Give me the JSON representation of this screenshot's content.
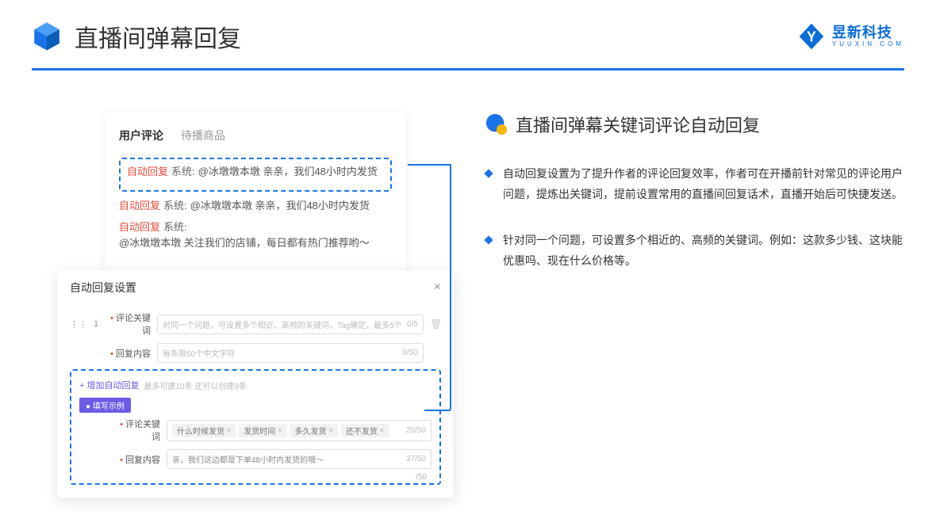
{
  "header": {
    "title": "直播间弹幕回复",
    "logo_cn": "昱新科技",
    "logo_en": "YUUXIN.COM"
  },
  "card1": {
    "tabs": {
      "user_comment": "用户评论",
      "goods": "待播商品"
    },
    "auto_tag": "自动回复",
    "sys_tag": "系统:",
    "c1": "@冰墩墩本墩 亲亲，我们48小时内发货",
    "c2": "@冰墩墩本墩 亲亲，我们48小时内发货",
    "c3": "@冰墩墩本墩 关注我们的店铺，每日都有热门推荐哟～"
  },
  "card2": {
    "title": "自动回复设置",
    "idx": "1",
    "lbl_keyword": "评论关键词",
    "ph_keyword": "对同一个问题，可设置多个相近、高频的关键词，Tag确定，最多5个",
    "count_keyword": "0/5",
    "lbl_content": "回复内容",
    "ph_content": "每条限50个中文字符",
    "count_content": "0/50",
    "add_link": "+ 增加自动回复",
    "add_hint": "最多可建10条 还可以创建9条",
    "badge": "● 填写示例",
    "ex_lbl_keyword": "评论关键词",
    "ex_tags": [
      "什么时候发货",
      "发货时间",
      "多久发货",
      "还不发货"
    ],
    "ex_kw_count": "20/50",
    "ex_lbl_content": "回复内容",
    "ex_content_text": "亲，我们这边都是下单48小时内发货的哦～",
    "ex_content_count": "37/50",
    "ext_count": "/50"
  },
  "right": {
    "title": "直播间弹幕关键词评论自动回复",
    "p1": "自动回复设置为了提升作者的评论回复效率，作者可在开播前针对常见的评论用户问题，提炼出关键词，提前设置常用的直播间回复话术，直播开始后可快捷发送。",
    "p2": "针对同一个问题，可设置多个相近的、高频的关键词。例如：这款多少钱、这块能优惠吗、现在什么价格等。"
  }
}
